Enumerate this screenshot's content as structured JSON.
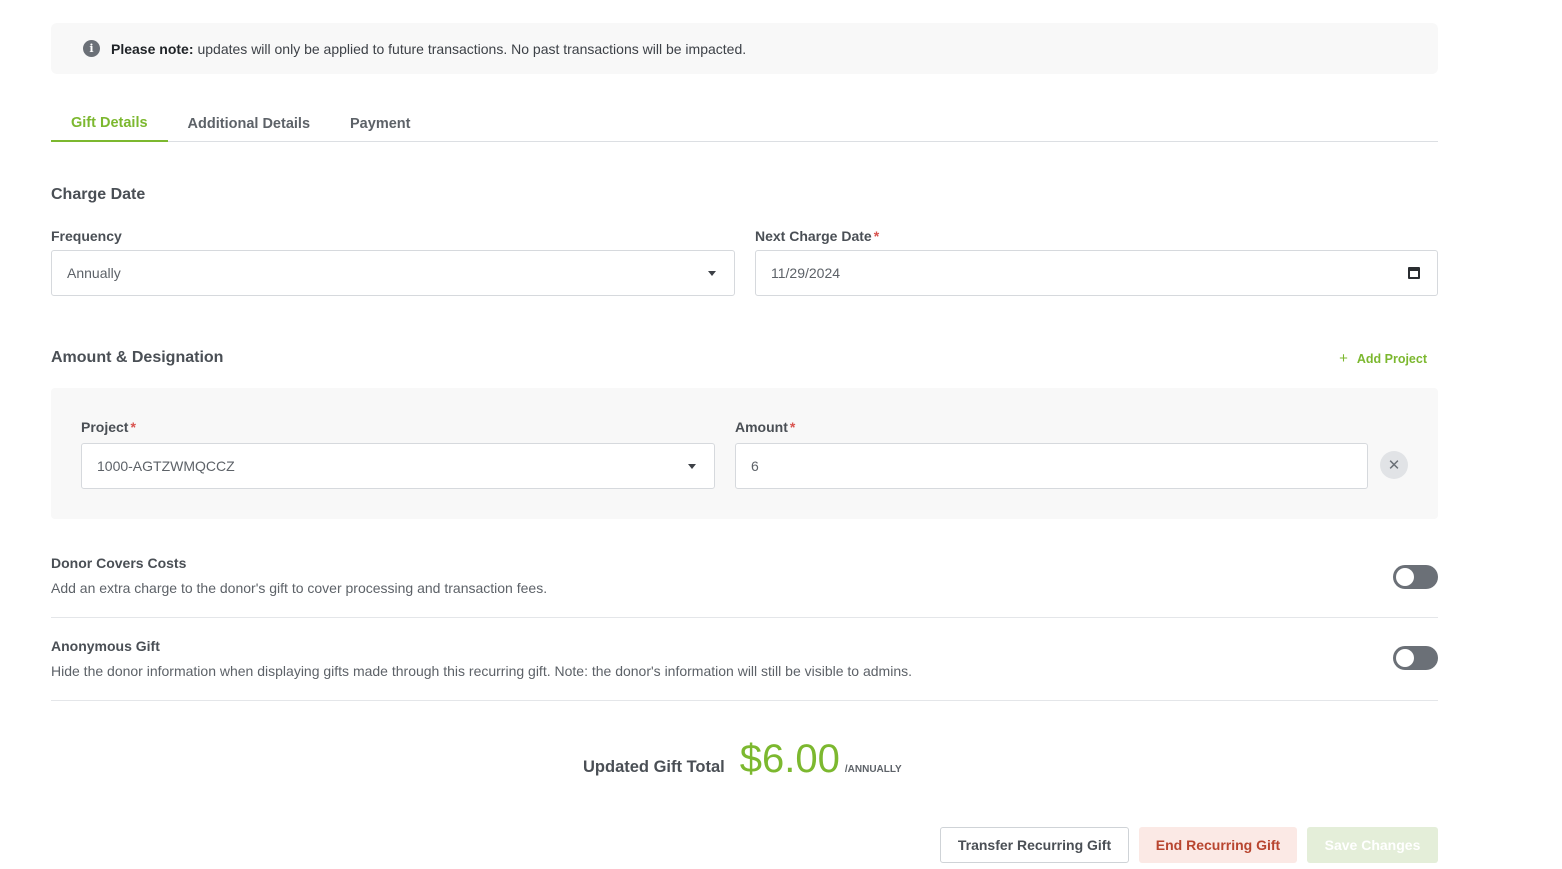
{
  "notice": {
    "bold": "Please note:",
    "text": "updates will only be applied to future transactions. No past transactions will be impacted."
  },
  "tabs": [
    {
      "label": "Gift Details",
      "active": true
    },
    {
      "label": "Additional Details",
      "active": false
    },
    {
      "label": "Payment",
      "active": false
    }
  ],
  "charge_date": {
    "title": "Charge Date",
    "frequency_label": "Frequency",
    "frequency_value": "Annually",
    "next_charge_label": "Next Charge Date",
    "next_charge_value": "11/29/2024",
    "required_mark": "*"
  },
  "amount_designation": {
    "title": "Amount & Designation",
    "add_project_label": "Add Project",
    "project_label": "Project",
    "project_value": "1000-AGTZWMQCCZ",
    "amount_label": "Amount",
    "amount_value": "6",
    "remove_symbol": "✕"
  },
  "donor_covers": {
    "title": "Donor Covers Costs",
    "description": "Add an extra charge to the donor's gift to cover processing and transaction fees.",
    "enabled": false
  },
  "anonymous": {
    "title": "Anonymous Gift",
    "description": "Hide the donor information when displaying gifts made through this recurring gift. Note: the donor's information will still be visible to admins.",
    "enabled": false
  },
  "total": {
    "label": "Updated Gift Total",
    "amount": "$6.00",
    "period": "/ANNUALLY"
  },
  "actions": {
    "transfer": "Transfer Recurring Gift",
    "end": "End Recurring Gift",
    "save": "Save Changes"
  },
  "colors": {
    "accent": "#7cb82f",
    "danger": "#b8452f",
    "toggle_off": "#6b7077"
  }
}
